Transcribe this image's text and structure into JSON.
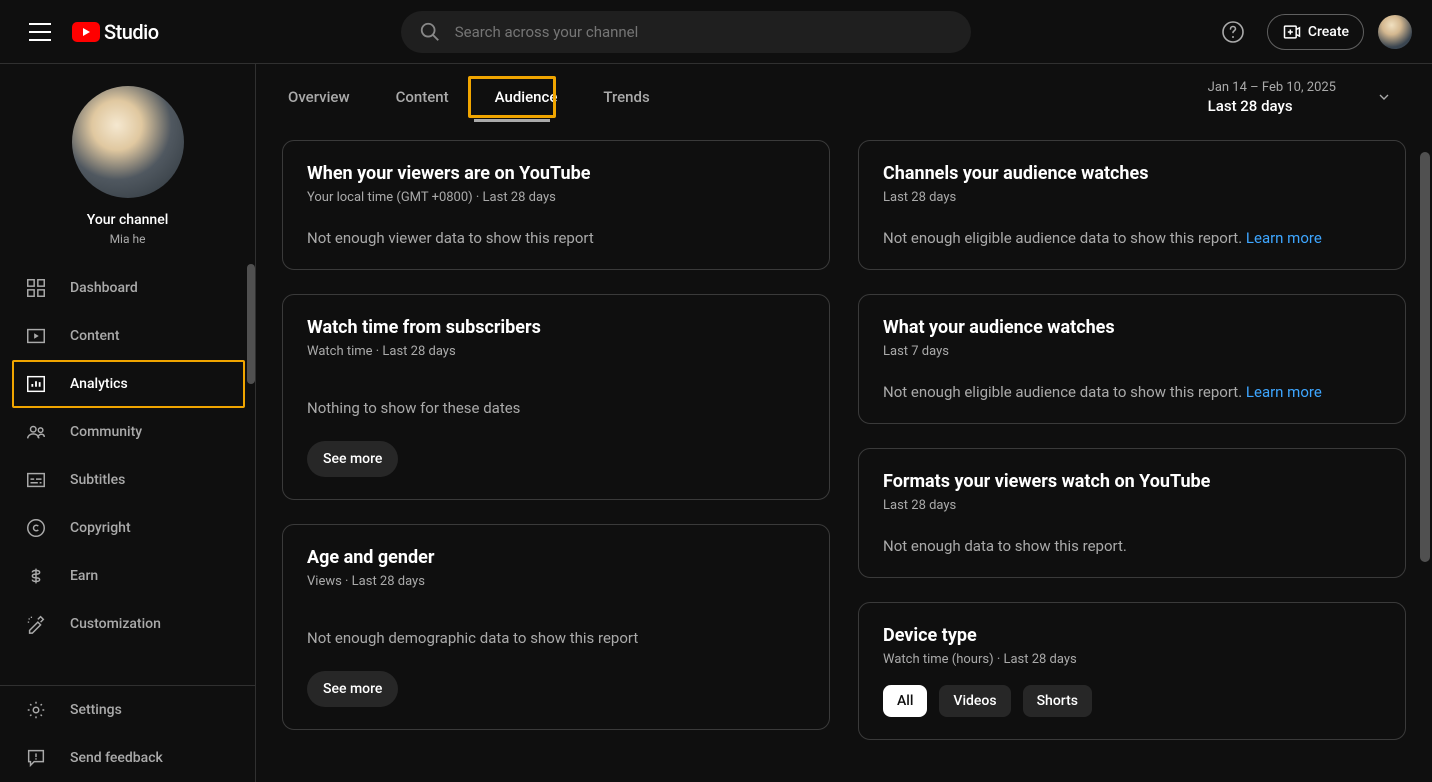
{
  "header": {
    "logo_text": "Studio",
    "search_placeholder": "Search across your channel",
    "create_label": "Create"
  },
  "sidebar": {
    "channel_label": "Your channel",
    "channel_name": "Mia he",
    "items": [
      {
        "icon": "dashboard",
        "label": "Dashboard"
      },
      {
        "icon": "content",
        "label": "Content"
      },
      {
        "icon": "analytics",
        "label": "Analytics"
      },
      {
        "icon": "community",
        "label": "Community"
      },
      {
        "icon": "subtitles",
        "label": "Subtitles"
      },
      {
        "icon": "copyright",
        "label": "Copyright"
      },
      {
        "icon": "earn",
        "label": "Earn"
      },
      {
        "icon": "customization",
        "label": "Customization"
      }
    ],
    "bottom": [
      {
        "icon": "settings",
        "label": "Settings"
      },
      {
        "icon": "feedback",
        "label": "Send feedback"
      }
    ]
  },
  "tabs": {
    "items": [
      "Overview",
      "Content",
      "Audience",
      "Trends"
    ],
    "active_index": 2
  },
  "date": {
    "range": "Jan 14 – Feb 10, 2025",
    "label": "Last 28 days"
  },
  "cards": {
    "left": [
      {
        "title": "When your viewers are on YouTube",
        "sub": "Your local time (GMT +0800) · Last 28 days",
        "msg": "Not enough viewer data to show this report",
        "see_more": false
      },
      {
        "title": "Watch time from subscribers",
        "sub": "Watch time · Last 28 days",
        "msg": "Nothing to show for these dates",
        "see_more": true
      },
      {
        "title": "Age and gender",
        "sub": "Views · Last 28 days",
        "msg": "Not enough demographic data to show this report",
        "see_more": true
      }
    ],
    "right": [
      {
        "title": "Channels your audience watches",
        "sub": "Last 28 days",
        "msg": "Not enough eligible audience data to show this report. ",
        "learn_more": true
      },
      {
        "title": "What your audience watches",
        "sub": "Last 7 days",
        "msg": "Not enough eligible audience data to show this report. ",
        "learn_more": true
      },
      {
        "title": "Formats your viewers watch on YouTube",
        "sub": "Last 28 days",
        "msg": "Not enough data to show this report."
      },
      {
        "title": "Device type",
        "sub": "Watch time (hours) · Last 28 days",
        "chips": [
          "All",
          "Videos",
          "Shorts"
        ],
        "chip_active": 0
      }
    ]
  },
  "buttons": {
    "see_more": "See more",
    "learn_more": "Learn more"
  }
}
